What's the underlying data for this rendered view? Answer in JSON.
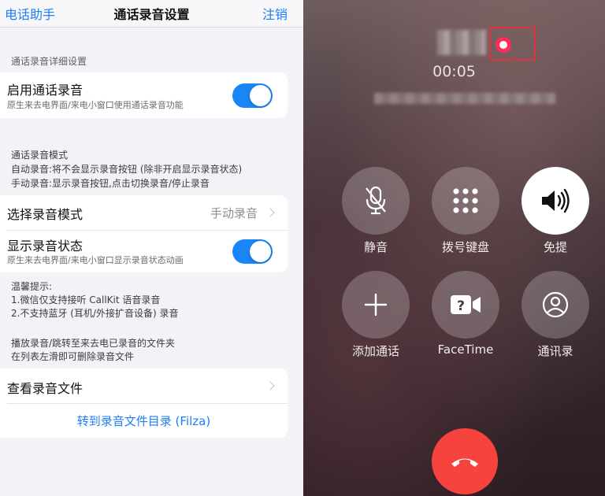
{
  "settings": {
    "nav": {
      "back": "电话助手",
      "title": "通话录音设置",
      "action": "注销"
    },
    "detail_header": "通话录音详细设置",
    "enable_recording": {
      "title": "启用通话录音",
      "subtitle": "原生来去电界面/来电小窗口使用通话录音功能",
      "enabled": true
    },
    "mode_info": [
      "通话录音模式",
      "自动录音:将不会显示录音按钮 (除非开启显示录音状态)",
      "手动录音:显示录音按钮,点击切换录音/停止录音"
    ],
    "select_mode": {
      "title": "选择录音模式",
      "value": "手动录音"
    },
    "show_status": {
      "title": "显示录音状态",
      "subtitle": "原生来去电界面/来电小窗口显示录音状态动画",
      "enabled": true
    },
    "tips": [
      "温馨提示:",
      "1.微信仅支持接听 CallKit 语音录音",
      "2.不支持蓝牙 (耳机/外接扩音设备) 录音"
    ],
    "playback_info": [
      "播放录音/跳转至来去电已录音的文件夹",
      "在列表左滑即可删除录音文件"
    ],
    "view_files": "查看录音文件",
    "goto_dir": "转到录音文件目录 (Filza)"
  },
  "call": {
    "timer": "00:05",
    "buttons": {
      "mute": "静音",
      "keypad": "拨号键盘",
      "speaker": "免提",
      "add_call": "添加通话",
      "facetime": "FaceTime",
      "contacts": "通讯录"
    },
    "colors": {
      "end_call": "#f6433d",
      "recording": "#ff2d55"
    }
  }
}
